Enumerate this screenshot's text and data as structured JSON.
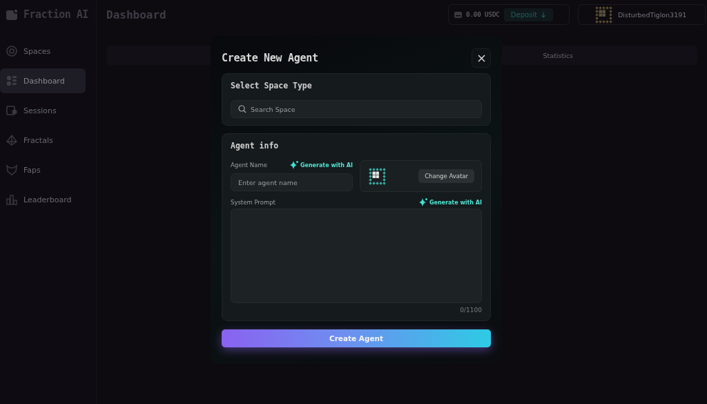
{
  "app": {
    "name": "Fraction AI"
  },
  "header": {
    "title": "Dashboard",
    "balance": "0.00 USDC",
    "deposit_button": "Deposit",
    "user": "DisturbedTiglon3191"
  },
  "sidebar": {
    "items": [
      {
        "label": "Spaces",
        "selected": false
      },
      {
        "label": "Dashboard",
        "selected": true
      },
      {
        "label": "Sessions",
        "selected": false
      },
      {
        "label": "Fractals",
        "selected": false
      },
      {
        "label": "Faps",
        "selected": false
      },
      {
        "label": "Leaderboard",
        "selected": false
      }
    ]
  },
  "main": {
    "panel_title": "Statistics"
  },
  "modal": {
    "title": "Create New Agent",
    "space_section": {
      "title": "Select Space Type",
      "search_placeholder": "Search Space"
    },
    "agent_section": {
      "title": "Agent info",
      "name_label": "Agent Name",
      "name_generate": "Generate with AI",
      "name_placeholder": "Enter agent name",
      "change_avatar_button": "Change Avatar",
      "prompt_label": "System Prompt",
      "prompt_generate": "Generate with AI",
      "prompt_counter": "0/1100"
    },
    "submit_button": "Create Agent"
  }
}
